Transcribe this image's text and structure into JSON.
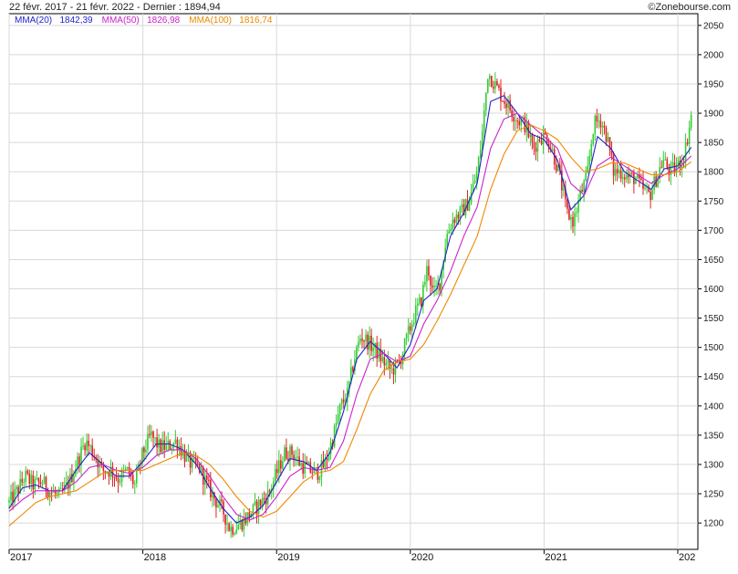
{
  "header": {
    "title": "22 févr. 2017 - 21 févr. 2022 - Dernier : 1894,94",
    "brand": "©Zonebourse.com"
  },
  "legend": [
    {
      "label": "MMA(20)",
      "value": "1842,39",
      "color": "#2222cc"
    },
    {
      "label": "MMA(50)",
      "value": "1826,98",
      "color": "#cc22cc"
    },
    {
      "label": "MMA(100)",
      "value": "1816,74",
      "color": "#ee8800"
    }
  ],
  "colors": {
    "up": "#33cc33",
    "down": "#dd2222",
    "grid": "#d8d8d8",
    "axis": "#000000"
  },
  "chart_data": {
    "type": "line",
    "ylim": [
      1155,
      2070
    ],
    "xlim": [
      2017.0,
      2022.15
    ],
    "y_ticks": [
      1200,
      1250,
      1300,
      1350,
      1400,
      1450,
      1500,
      1550,
      1600,
      1650,
      1700,
      1750,
      1800,
      1850,
      1900,
      1950,
      2000,
      2050
    ],
    "x_ticks": [
      {
        "x": 2017.0,
        "label": "2017"
      },
      {
        "x": 2018.0,
        "label": "2018"
      },
      {
        "x": 2019.0,
        "label": "2019"
      },
      {
        "x": 2020.0,
        "label": "2020"
      },
      {
        "x": 2021.0,
        "label": "2021"
      },
      {
        "x": 2022.0,
        "label": "202"
      }
    ],
    "grid": true,
    "price_points": [
      [
        2017.0,
        1235
      ],
      [
        2017.06,
        1255
      ],
      [
        2017.12,
        1280
      ],
      [
        2017.18,
        1265
      ],
      [
        2017.25,
        1270
      ],
      [
        2017.3,
        1255
      ],
      [
        2017.38,
        1245
      ],
      [
        2017.45,
        1270
      ],
      [
        2017.52,
        1310
      ],
      [
        2017.57,
        1340
      ],
      [
        2017.63,
        1320
      ],
      [
        2017.7,
        1290
      ],
      [
        2017.76,
        1290
      ],
      [
        2017.82,
        1275
      ],
      [
        2017.88,
        1290
      ],
      [
        2017.94,
        1265
      ],
      [
        2018.0,
        1320
      ],
      [
        2018.06,
        1350
      ],
      [
        2018.12,
        1330
      ],
      [
        2018.18,
        1330
      ],
      [
        2018.25,
        1340
      ],
      [
        2018.3,
        1320
      ],
      [
        2018.36,
        1300
      ],
      [
        2018.42,
        1295
      ],
      [
        2018.48,
        1265
      ],
      [
        2018.54,
        1240
      ],
      [
        2018.6,
        1220
      ],
      [
        2018.65,
        1190
      ],
      [
        2018.7,
        1195
      ],
      [
        2018.76,
        1205
      ],
      [
        2018.82,
        1220
      ],
      [
        2018.88,
        1235
      ],
      [
        2018.94,
        1250
      ],
      [
        2019.0,
        1285
      ],
      [
        2019.06,
        1320
      ],
      [
        2019.12,
        1320
      ],
      [
        2019.18,
        1300
      ],
      [
        2019.25,
        1290
      ],
      [
        2019.3,
        1285
      ],
      [
        2019.36,
        1300
      ],
      [
        2019.42,
        1345
      ],
      [
        2019.48,
        1400
      ],
      [
        2019.53,
        1420
      ],
      [
        2019.58,
        1480
      ],
      [
        2019.63,
        1520
      ],
      [
        2019.68,
        1510
      ],
      [
        2019.74,
        1495
      ],
      [
        2019.8,
        1475
      ],
      [
        2019.86,
        1460
      ],
      [
        2019.92,
        1475
      ],
      [
        2019.98,
        1520
      ],
      [
        2020.03,
        1555
      ],
      [
        2020.08,
        1580
      ],
      [
        2020.13,
        1640
      ],
      [
        2020.17,
        1590
      ],
      [
        2020.22,
        1610
      ],
      [
        2020.27,
        1690
      ],
      [
        2020.32,
        1720
      ],
      [
        2020.38,
        1730
      ],
      [
        2020.44,
        1750
      ],
      [
        2020.5,
        1800
      ],
      [
        2020.54,
        1870
      ],
      [
        2020.58,
        1970
      ],
      [
        2020.63,
        1950
      ],
      [
        2020.68,
        1930
      ],
      [
        2020.74,
        1910
      ],
      [
        2020.8,
        1890
      ],
      [
        2020.86,
        1880
      ],
      [
        2020.92,
        1840
      ],
      [
        2020.97,
        1860
      ],
      [
        2021.02,
        1860
      ],
      [
        2021.07,
        1830
      ],
      [
        2021.12,
        1790
      ],
      [
        2021.17,
        1730
      ],
      [
        2021.22,
        1715
      ],
      [
        2021.27,
        1760
      ],
      [
        2021.32,
        1790
      ],
      [
        2021.37,
        1880
      ],
      [
        2021.42,
        1890
      ],
      [
        2021.47,
        1860
      ],
      [
        2021.52,
        1800
      ],
      [
        2021.58,
        1800
      ],
      [
        2021.63,
        1790
      ],
      [
        2021.68,
        1790
      ],
      [
        2021.74,
        1770
      ],
      [
        2021.79,
        1760
      ],
      [
        2021.84,
        1790
      ],
      [
        2021.89,
        1820
      ],
      [
        2021.94,
        1800
      ],
      [
        2022.0,
        1810
      ],
      [
        2022.05,
        1830
      ],
      [
        2022.1,
        1894.94
      ]
    ],
    "series": [
      {
        "name": "MMA(20)",
        "values": [
          [
            2017.0,
            1225
          ],
          [
            2017.1,
            1260
          ],
          [
            2017.2,
            1265
          ],
          [
            2017.3,
            1255
          ],
          [
            2017.4,
            1255
          ],
          [
            2017.5,
            1290
          ],
          [
            2017.6,
            1320
          ],
          [
            2017.7,
            1300
          ],
          [
            2017.8,
            1280
          ],
          [
            2017.9,
            1280
          ],
          [
            2018.0,
            1305
          ],
          [
            2018.1,
            1335
          ],
          [
            2018.2,
            1335
          ],
          [
            2018.3,
            1325
          ],
          [
            2018.4,
            1300
          ],
          [
            2018.5,
            1260
          ],
          [
            2018.6,
            1225
          ],
          [
            2018.7,
            1200
          ],
          [
            2018.8,
            1210
          ],
          [
            2018.9,
            1230
          ],
          [
            2019.0,
            1270
          ],
          [
            2019.1,
            1310
          ],
          [
            2019.2,
            1305
          ],
          [
            2019.3,
            1290
          ],
          [
            2019.4,
            1320
          ],
          [
            2019.5,
            1390
          ],
          [
            2019.6,
            1480
          ],
          [
            2019.7,
            1510
          ],
          [
            2019.8,
            1490
          ],
          [
            2019.9,
            1465
          ],
          [
            2020.0,
            1505
          ],
          [
            2020.1,
            1580
          ],
          [
            2020.2,
            1600
          ],
          [
            2020.3,
            1690
          ],
          [
            2020.4,
            1730
          ],
          [
            2020.5,
            1780
          ],
          [
            2020.6,
            1920
          ],
          [
            2020.7,
            1930
          ],
          [
            2020.8,
            1900
          ],
          [
            2020.9,
            1865
          ],
          [
            2021.0,
            1855
          ],
          [
            2021.1,
            1820
          ],
          [
            2021.2,
            1735
          ],
          [
            2021.3,
            1760
          ],
          [
            2021.4,
            1860
          ],
          [
            2021.5,
            1840
          ],
          [
            2021.6,
            1800
          ],
          [
            2021.7,
            1785
          ],
          [
            2021.8,
            1770
          ],
          [
            2021.9,
            1805
          ],
          [
            2022.0,
            1810
          ],
          [
            2022.1,
            1842
          ]
        ]
      },
      {
        "name": "MMA(50)",
        "values": [
          [
            2017.0,
            1220
          ],
          [
            2017.1,
            1240
          ],
          [
            2017.2,
            1255
          ],
          [
            2017.3,
            1255
          ],
          [
            2017.4,
            1255
          ],
          [
            2017.5,
            1270
          ],
          [
            2017.6,
            1295
          ],
          [
            2017.7,
            1300
          ],
          [
            2017.8,
            1290
          ],
          [
            2017.9,
            1285
          ],
          [
            2018.0,
            1295
          ],
          [
            2018.1,
            1315
          ],
          [
            2018.2,
            1325
          ],
          [
            2018.3,
            1325
          ],
          [
            2018.4,
            1310
          ],
          [
            2018.5,
            1280
          ],
          [
            2018.6,
            1245
          ],
          [
            2018.7,
            1215
          ],
          [
            2018.8,
            1205
          ],
          [
            2018.9,
            1215
          ],
          [
            2019.0,
            1245
          ],
          [
            2019.1,
            1280
          ],
          [
            2019.2,
            1295
          ],
          [
            2019.3,
            1290
          ],
          [
            2019.4,
            1295
          ],
          [
            2019.5,
            1340
          ],
          [
            2019.6,
            1420
          ],
          [
            2019.7,
            1480
          ],
          [
            2019.8,
            1490
          ],
          [
            2019.9,
            1475
          ],
          [
            2020.0,
            1485
          ],
          [
            2020.1,
            1540
          ],
          [
            2020.2,
            1580
          ],
          [
            2020.3,
            1630
          ],
          [
            2020.4,
            1690
          ],
          [
            2020.5,
            1740
          ],
          [
            2020.6,
            1840
          ],
          [
            2020.7,
            1890
          ],
          [
            2020.8,
            1900
          ],
          [
            2020.9,
            1880
          ],
          [
            2021.0,
            1860
          ],
          [
            2021.1,
            1840
          ],
          [
            2021.2,
            1780
          ],
          [
            2021.3,
            1760
          ],
          [
            2021.4,
            1810
          ],
          [
            2021.5,
            1825
          ],
          [
            2021.6,
            1810
          ],
          [
            2021.7,
            1795
          ],
          [
            2021.8,
            1780
          ],
          [
            2021.9,
            1795
          ],
          [
            2022.0,
            1805
          ],
          [
            2022.1,
            1827
          ]
        ]
      },
      {
        "name": "MMA(100)",
        "values": [
          [
            2017.0,
            1195
          ],
          [
            2017.1,
            1215
          ],
          [
            2017.2,
            1235
          ],
          [
            2017.3,
            1245
          ],
          [
            2017.4,
            1250
          ],
          [
            2017.5,
            1255
          ],
          [
            2017.6,
            1270
          ],
          [
            2017.7,
            1285
          ],
          [
            2017.8,
            1290
          ],
          [
            2017.9,
            1290
          ],
          [
            2018.0,
            1290
          ],
          [
            2018.1,
            1300
          ],
          [
            2018.2,
            1310
          ],
          [
            2018.3,
            1320
          ],
          [
            2018.4,
            1315
          ],
          [
            2018.5,
            1300
          ],
          [
            2018.6,
            1275
          ],
          [
            2018.7,
            1245
          ],
          [
            2018.8,
            1220
          ],
          [
            2018.9,
            1210
          ],
          [
            2019.0,
            1220
          ],
          [
            2019.1,
            1245
          ],
          [
            2019.2,
            1270
          ],
          [
            2019.3,
            1285
          ],
          [
            2019.4,
            1290
          ],
          [
            2019.5,
            1305
          ],
          [
            2019.6,
            1360
          ],
          [
            2019.7,
            1420
          ],
          [
            2019.8,
            1460
          ],
          [
            2019.9,
            1475
          ],
          [
            2020.0,
            1480
          ],
          [
            2020.1,
            1505
          ],
          [
            2020.2,
            1545
          ],
          [
            2020.3,
            1590
          ],
          [
            2020.4,
            1640
          ],
          [
            2020.5,
            1690
          ],
          [
            2020.6,
            1770
          ],
          [
            2020.7,
            1830
          ],
          [
            2020.8,
            1870
          ],
          [
            2020.9,
            1880
          ],
          [
            2021.0,
            1870
          ],
          [
            2021.1,
            1855
          ],
          [
            2021.2,
            1825
          ],
          [
            2021.3,
            1800
          ],
          [
            2021.4,
            1805
          ],
          [
            2021.5,
            1815
          ],
          [
            2021.6,
            1815
          ],
          [
            2021.7,
            1805
          ],
          [
            2021.8,
            1795
          ],
          [
            2021.9,
            1795
          ],
          [
            2022.0,
            1800
          ],
          [
            2022.1,
            1817
          ]
        ]
      }
    ]
  }
}
